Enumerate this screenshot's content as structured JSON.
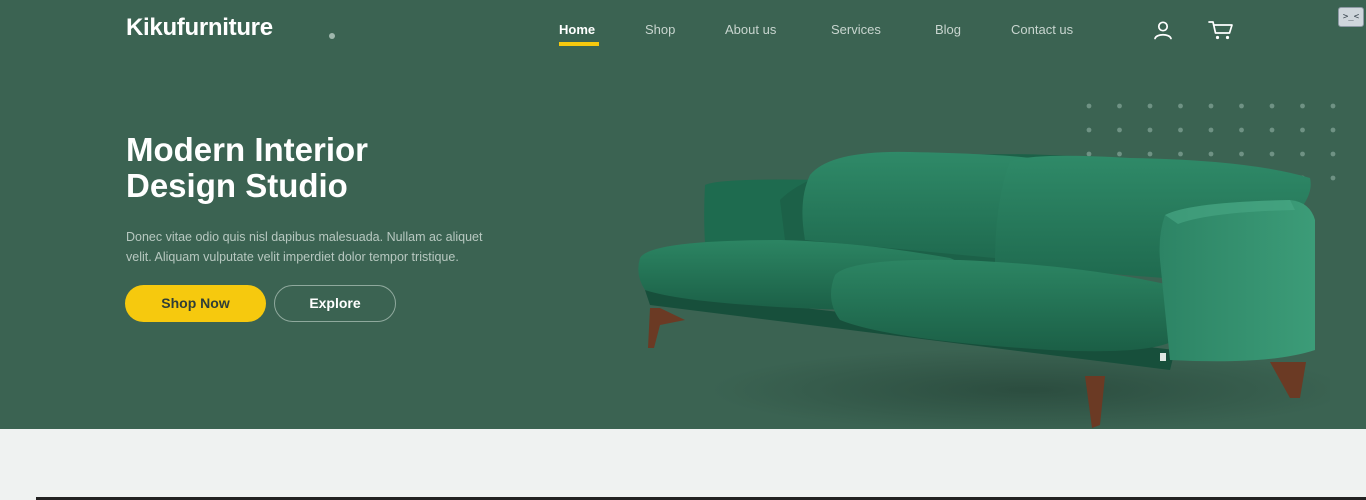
{
  "brand": {
    "name": "Kikufurniture"
  },
  "nav": {
    "items": [
      {
        "label": "Home",
        "active": true
      },
      {
        "label": "Shop"
      },
      {
        "label": "About us"
      },
      {
        "label": "Services"
      },
      {
        "label": "Blog"
      },
      {
        "label": "Contact us"
      }
    ],
    "icons": [
      "user-icon",
      "cart-icon"
    ]
  },
  "hero": {
    "title_line1": "Modern Interior",
    "title_line2": "Design Studio",
    "description_line1": "Donec vitae odio quis nisl dapibus malesuada. Nullam ac aliquet",
    "description_line2": "velit. Aliquam vulputate velit imperdiet dolor tempor tristique.",
    "primary_button": "Shop Now",
    "secondary_button": "Explore",
    "image": "green-velvet-sofa"
  },
  "extension_widget": {
    "label": ">_<"
  },
  "colors": {
    "hero_bg": "#3b6352",
    "accent": "#f6c90e",
    "page_bg": "#eff2f1"
  }
}
